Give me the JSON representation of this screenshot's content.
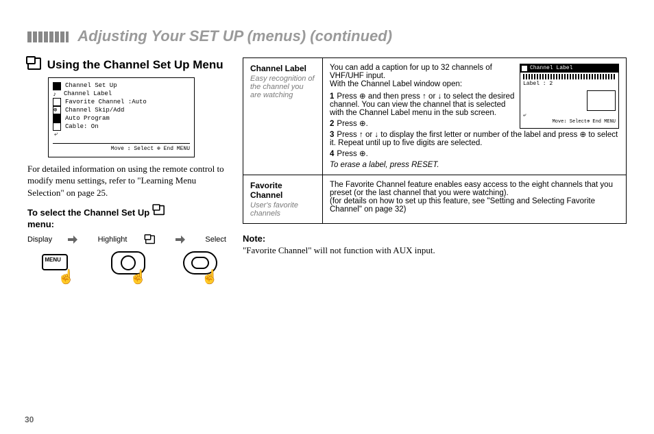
{
  "pageTitle": "Adjusting Your SET UP (menus) (continued)",
  "left": {
    "heading": "Using the Channel Set Up Menu",
    "osd": {
      "title": "Channel Set Up",
      "items": [
        "Channel Label",
        "Favorite Channel :Auto",
        "Channel Skip/Add",
        "Auto Program",
        "Cable:            On"
      ],
      "footer": "Move ↕  Select ⊕  End MENU"
    },
    "para": "For detailed information on using the remote control to modify menu settings, refer to \"Learning Menu Selection\" on page 25.",
    "subheading": "To select the Channel Set Up",
    "subheading2": "menu:",
    "nav": {
      "a": "Display",
      "b": "Highlight",
      "c": "Select"
    },
    "menuLabel": "MENU"
  },
  "right": {
    "rows": [
      {
        "name": "Channel Label",
        "sub": "Easy recognition of the channel you are watching",
        "body": {
          "intro": "You can add a caption for up to 32 channels of VHF/UHF input.",
          "open": "With the Channel Label window open:",
          "steps": [
            "Press ⊕ and then press ↑ or ↓ to select the desired channel. You can view the channel that is selected with the Channel Label menu in the sub screen.",
            "Press ⊕.",
            "Press ↑ or ↓ to display the first letter or number of the label and press ⊕ to select it. Repeat until up to five digits are selected.",
            "Press ⊕."
          ],
          "erase": "To erase a label, press RESET.",
          "miniOsd": {
            "title": "Channel Label",
            "label": "Label : 2",
            "footer": "Move↕ Select⊕ End MENU"
          }
        }
      },
      {
        "name": "Favorite Channel",
        "sub": "User's favorite channels",
        "body": {
          "text1": "The Favorite Channel feature enables easy access to the eight channels that you preset (or the last channel that you were watching).",
          "text2": "(for details on how to set up this feature, see \"Setting and Selecting Favorite Channel\" on page 32)"
        }
      }
    ],
    "noteHeading": "Note:",
    "noteBody": "\"Favorite Channel\" will not function with AUX input."
  },
  "pageNumber": "30"
}
